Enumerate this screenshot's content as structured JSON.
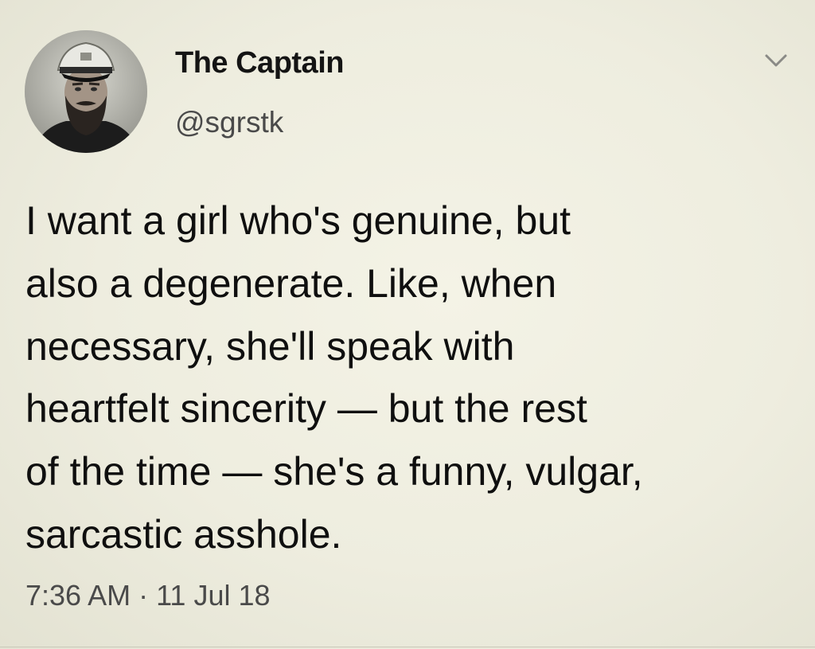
{
  "tweet": {
    "author": {
      "display_name": "The Captain",
      "handle": "@sgrstk",
      "avatar_icon": "profile-photo"
    },
    "menu_icon": "chevron-down-icon",
    "text_lines": [
      "I want a girl who's genuine, but",
      "also a degenerate. Like, when",
      "necessary, she'll speak with",
      "heartfelt sincerity — but the rest",
      "of the time — she's a funny, vulgar,",
      "sarcastic asshole."
    ],
    "timestamp": "7:36 AM · 11 Jul 18"
  },
  "colors": {
    "background": "#efeee1",
    "text": "#111111",
    "secondary_text": "#4a4a4a"
  }
}
